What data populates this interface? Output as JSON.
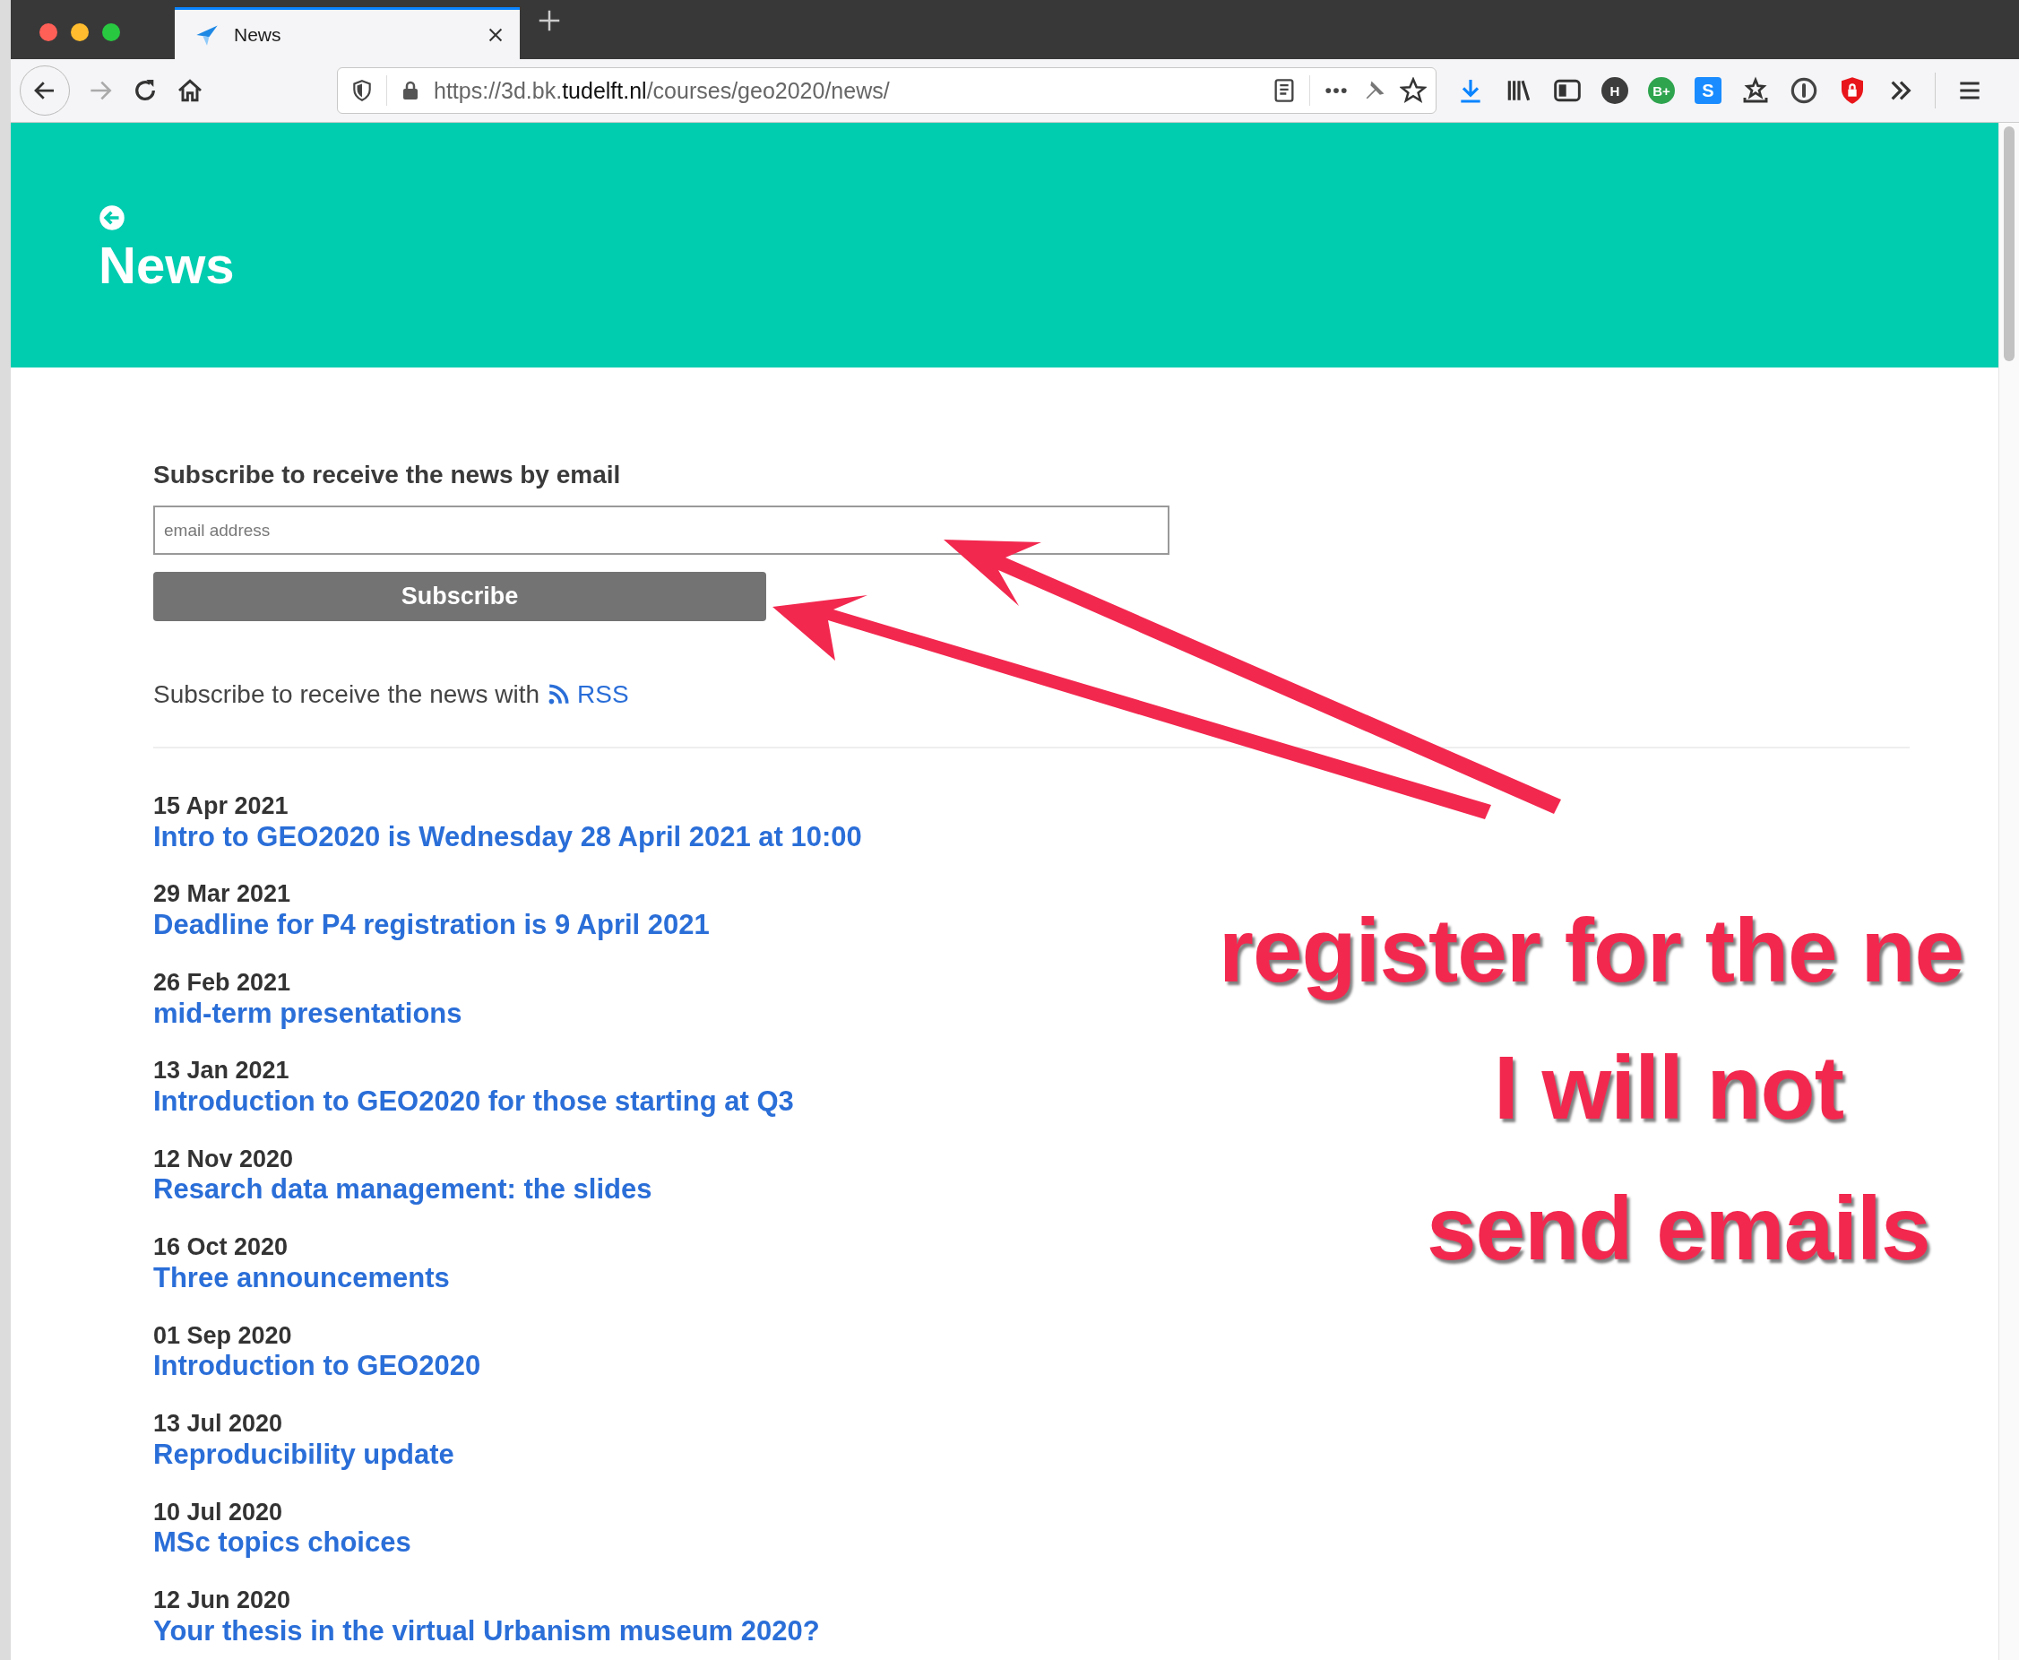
{
  "browser": {
    "tabs": [
      {
        "title": "News",
        "selected": true
      }
    ],
    "url": {
      "prefix": "https://3d.bk.",
      "domain": "tudelft.nl",
      "path": "/courses/geo2020/news/"
    },
    "extension_badges": [
      {
        "label": "H",
        "kind": "circle",
        "color": "#3d3d3d"
      },
      {
        "label": "B+",
        "kind": "circle",
        "color": "#2ea44f"
      },
      {
        "label": "S",
        "kind": "square",
        "color": "#1a8cff"
      }
    ]
  },
  "header": {
    "title": "News"
  },
  "subscribe": {
    "heading": "Subscribe to receive the news by email",
    "email_field": {
      "placeholder": "email address"
    },
    "button": "Subscribe",
    "rss_text": "Subscribe to receive the news with",
    "rss_link": "RSS"
  },
  "news": [
    {
      "date": "15 Apr 2021",
      "title": "Intro to GEO2020 is Wednesday 28 April 2021 at 10:00"
    },
    {
      "date": "29 Mar 2021",
      "title": "Deadline for P4 registration is 9 April 2021"
    },
    {
      "date": "26 Feb 2021",
      "title": "mid-term presentations"
    },
    {
      "date": "13 Jan 2021",
      "title": "Introduction to GEO2020 for those starting at Q3"
    },
    {
      "date": "12 Nov 2020",
      "title": "Resarch data management: the slides"
    },
    {
      "date": "16 Oct 2020",
      "title": "Three announcements"
    },
    {
      "date": "01 Sep 2020",
      "title": "Introduction to GEO2020"
    },
    {
      "date": "13 Jul 2020",
      "title": "Reproducibility update"
    },
    {
      "date": "10 Jul 2020",
      "title": "MSc topics choices"
    },
    {
      "date": "12 Jun 2020",
      "title": "Your thesis in the virtual Urbanism museum 2020?"
    }
  ],
  "annotation": {
    "lines": [
      "register for the ne",
      "I will not",
      "send emails"
    ]
  }
}
